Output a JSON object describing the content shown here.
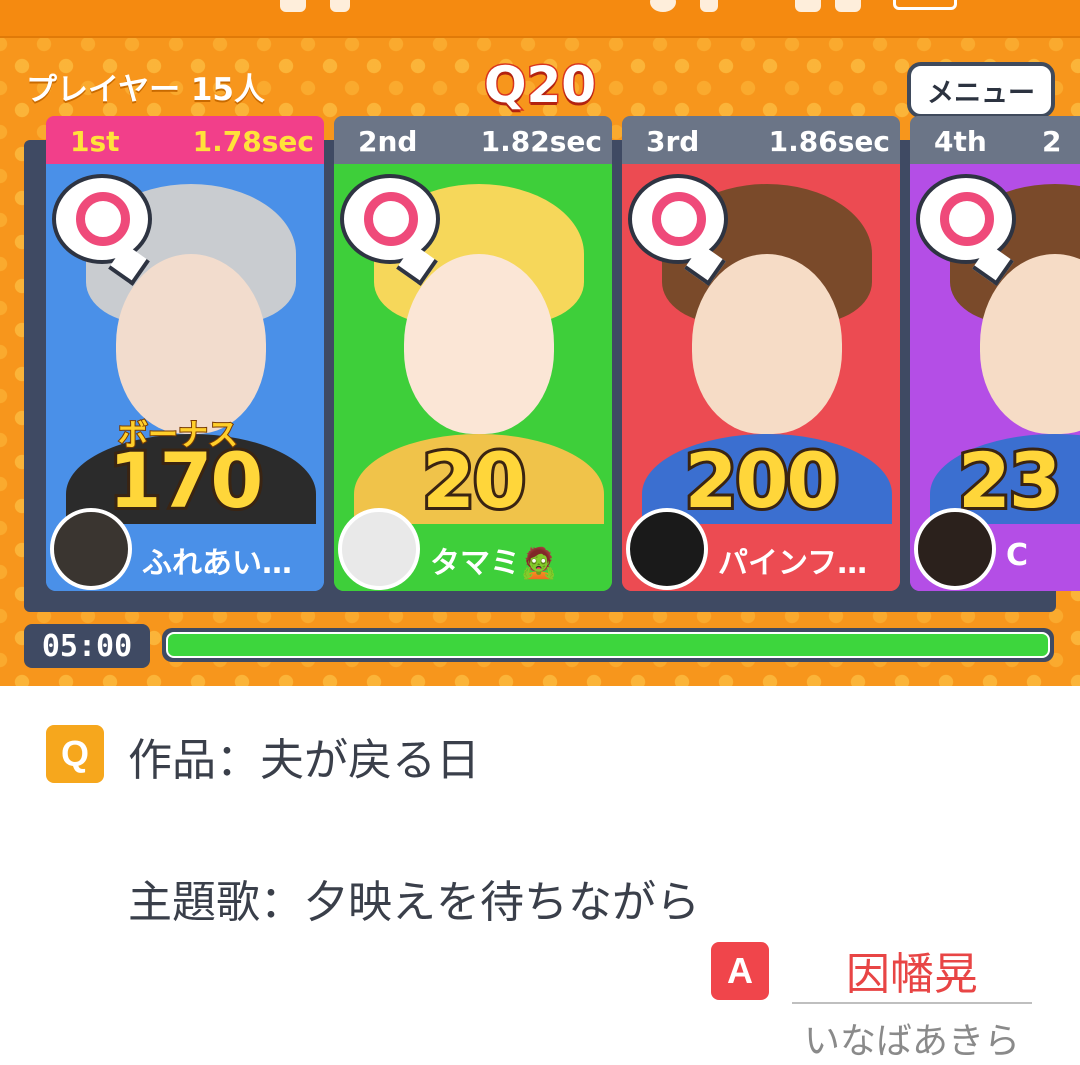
{
  "header": {
    "players_label": "プレイヤー 15人",
    "question_number": "Q20",
    "menu_label": "メニュー"
  },
  "players": [
    {
      "rank": "1st",
      "time": "1.78sec",
      "bonus_label": "ボーナス",
      "score": "170",
      "name": "ふれあい…",
      "head_color": "#f23f8a",
      "card_color": "#4a90e8",
      "strip_color": "#4a90e8"
    },
    {
      "rank": "2nd",
      "time": "1.82sec",
      "bonus_label": "",
      "score": "20",
      "name": "タマミ🧟",
      "head_color": "#6b7587",
      "card_color": "#3ecf3a",
      "strip_color": "#3ecf3a"
    },
    {
      "rank": "3rd",
      "time": "1.86sec",
      "bonus_label": "",
      "score": "200",
      "name": "パインフ…",
      "head_color": "#6b7587",
      "card_color": "#ec4b52",
      "strip_color": "#ec4b52"
    },
    {
      "rank": "4th",
      "time": "2",
      "bonus_label": "",
      "score": "23",
      "name": "C",
      "head_color": "#6b7587",
      "card_color": "#b44ee6",
      "strip_color": "#b44ee6"
    }
  ],
  "timer": {
    "remaining": "05:00",
    "progress_fraction": 1.0
  },
  "question": {
    "badge": "Q",
    "line1": "作品：夫が戻る日",
    "line2": "主題歌：夕映えを待ちながら"
  },
  "answer": {
    "badge": "A",
    "text": "因幡晃",
    "reading": "いなばあきら"
  }
}
